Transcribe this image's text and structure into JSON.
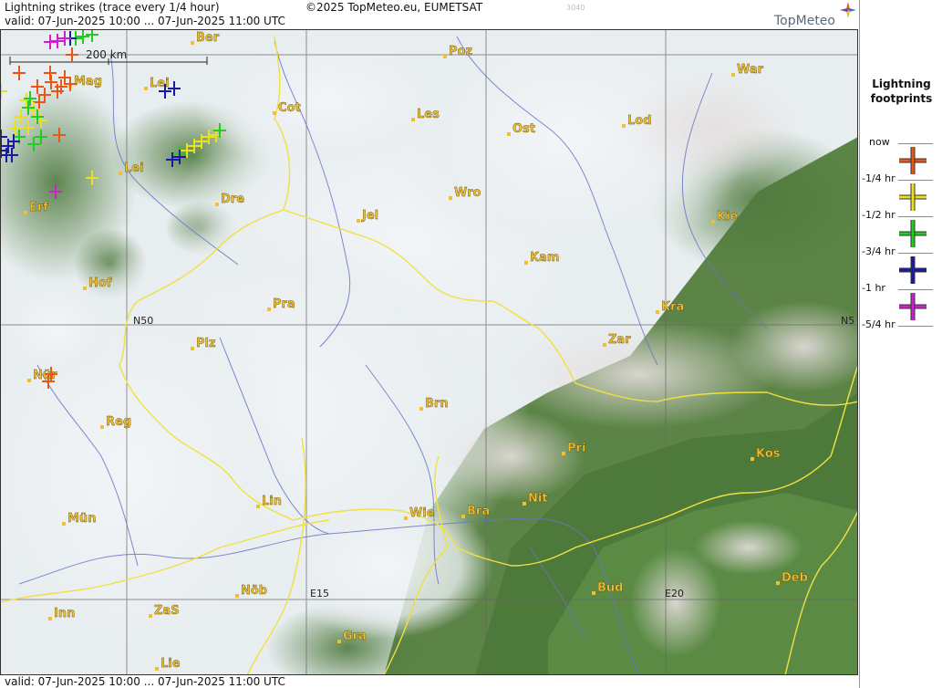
{
  "header": {
    "title": "Lightning strikes (trace every 1/4 hour)",
    "valid": "valid:  07-Jun-2025 10:00 ... 07-Jun-2025 11:00 UTC",
    "copyright": "©2025 TopMeteo.eu, EUMETSAT",
    "code": "3040",
    "logo": "TopMeteo"
  },
  "footer": {
    "valid": "valid:  07-Jun-2025 10:00 ... 07-Jun-2025 11:00 UTC"
  },
  "scale": {
    "label": "200 km"
  },
  "grid_labels": {
    "n50": "N50",
    "n50_right": "N5",
    "e15": "E15",
    "e20": "E20"
  },
  "cities": [
    {
      "name": "Ber"
    },
    {
      "name": "Poz"
    },
    {
      "name": "War"
    },
    {
      "name": "Mag"
    },
    {
      "name": "Lei"
    },
    {
      "name": "Cot"
    },
    {
      "name": "Les"
    },
    {
      "name": "Ost"
    },
    {
      "name": "Lod"
    },
    {
      "name": "Lei"
    },
    {
      "name": "Erf"
    },
    {
      "name": "Dre"
    },
    {
      "name": "Wro"
    },
    {
      "name": "Jel"
    },
    {
      "name": "Kie"
    },
    {
      "name": "Kam"
    },
    {
      "name": "Hof"
    },
    {
      "name": "Pra"
    },
    {
      "name": "Kra"
    },
    {
      "name": "Zar"
    },
    {
      "name": "Plz"
    },
    {
      "name": "Nür"
    },
    {
      "name": "Brn"
    },
    {
      "name": "Reg"
    },
    {
      "name": "Pri"
    },
    {
      "name": "Kos"
    },
    {
      "name": "Lin"
    },
    {
      "name": "Nit"
    },
    {
      "name": "Wie"
    },
    {
      "name": "Bra"
    },
    {
      "name": "Mün"
    },
    {
      "name": "Bud"
    },
    {
      "name": "Deb"
    },
    {
      "name": "Nöb"
    },
    {
      "name": "Inn"
    },
    {
      "name": "ZaS"
    },
    {
      "name": "Gra"
    },
    {
      "name": "Lie"
    }
  ],
  "legend": {
    "title_line1": "Lightning",
    "title_line2": "footprints",
    "items": [
      {
        "label": "now",
        "color": "#e8561a"
      },
      {
        "label": "-1/4 hr",
        "color": "#e8e020"
      },
      {
        "label": "-1/2 hr",
        "color": "#22cc22"
      },
      {
        "label": "-3/4 hr",
        "color": "#1a1aa0"
      },
      {
        "label": "-1 hr",
        "color": "#cc22cc"
      },
      {
        "label": "-5/4 hr",
        "color": ""
      }
    ]
  },
  "colors": {
    "city": "#f0c030",
    "border": "#f0e040",
    "river": "#6a74c8",
    "grid": "#555555"
  }
}
